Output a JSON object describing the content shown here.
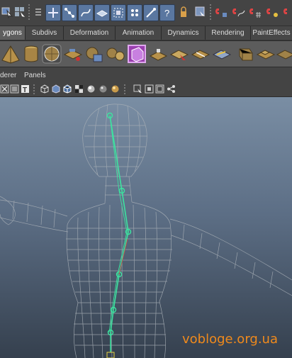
{
  "shelf_tabs": [
    "ygons",
    "Subdivs",
    "Deformation",
    "Animation",
    "Dynamics",
    "Rendering",
    "PaintEffects"
  ],
  "active_shelf_tab": "ygons",
  "panel_menu": [
    "derer",
    "Panels"
  ],
  "watermark": "vobloge.org.ua",
  "colors": {
    "accent_blue": "#5a77a0",
    "skeleton": "#3de3a0",
    "wireframe": "#a9b0b7",
    "watermark": "#f08a1c"
  },
  "toolbar_icons": [
    "select-tool-icon",
    "lasso-tool-icon",
    "menu-divider-icon",
    "move-tool-icon",
    "joint-tool-icon",
    "ik-handle-icon",
    "bind-skin-icon",
    "smooth-skin-icon",
    "paint-weights-icon",
    "mirror-joint-icon",
    "help-icon",
    "lock-icon",
    "select-hierarchy-icon",
    "magnet-snap-icon",
    "magnet-curve-icon",
    "magnet-grid-icon",
    "magnet-point-icon"
  ],
  "shelf_icons": [
    "pyramid-icon",
    "cylinder-icon",
    "sphere-icon",
    "plane-extrude-icon",
    "combine-icon",
    "separate-icon",
    "smooth-mesh-icon",
    "cube-icon",
    "plane-icon",
    "insert-edge-icon",
    "split-polygon-icon",
    "extrude-icon",
    "bevel-icon",
    "unfold-uv-icon",
    "planar-map-icon"
  ]
}
